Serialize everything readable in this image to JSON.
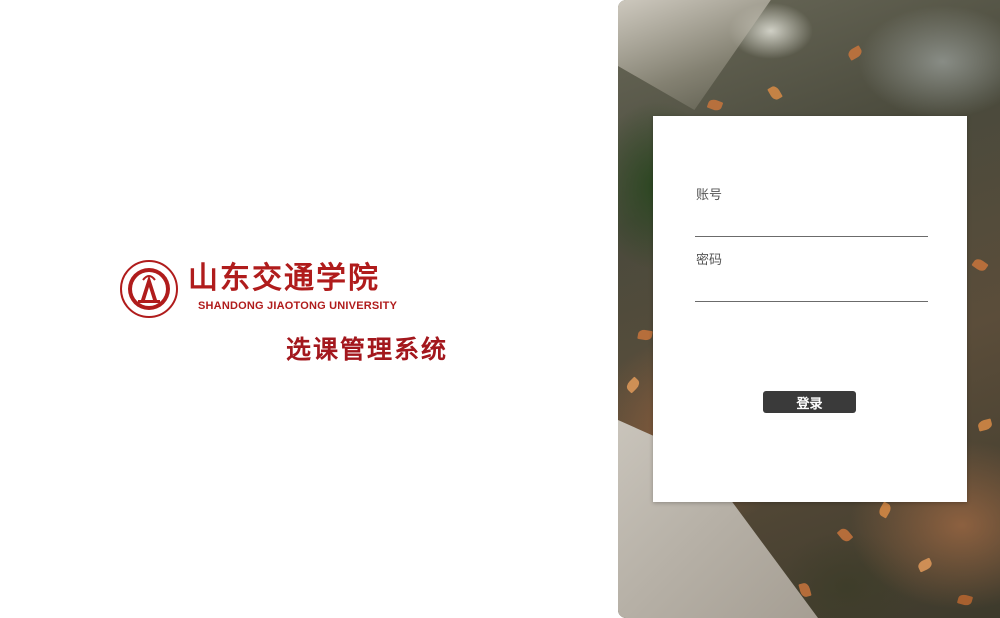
{
  "brand": {
    "school_name_cn": "山东交通学院",
    "school_name_en": "SHANDONG JIAOTONG UNIVERSITY",
    "system_title": "选课管理系统",
    "logo_icon": "university-seal-icon",
    "brand_color": "#b01c1c"
  },
  "login": {
    "account_label": "账号",
    "account_value": "",
    "password_label": "密码",
    "password_value": "",
    "submit_label": "登录",
    "button_color": "#3a3a3a"
  }
}
